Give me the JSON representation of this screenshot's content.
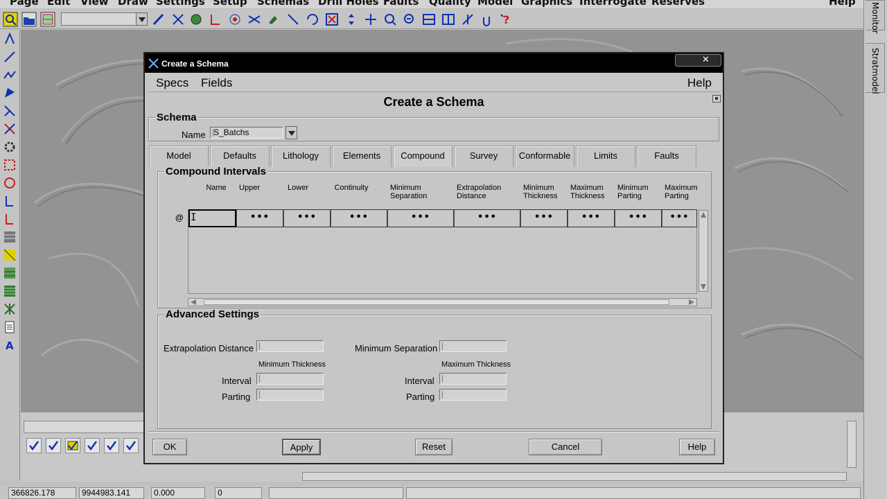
{
  "app": {
    "menu": [
      "Page",
      "Edit",
      "View",
      "Draw",
      "Settings",
      "Setup",
      "Schemas",
      "Drill Holes",
      "Faults",
      "Quality",
      "Model",
      "Graphics",
      "Interrogate",
      "Reserves",
      "Help"
    ],
    "right_tabs": [
      "Monitor",
      "Stratmodel"
    ],
    "status": {
      "x": "366826.178",
      "y": "9944983.141",
      "z": "0.000",
      "count": "0"
    }
  },
  "dialog": {
    "title": "Create a Schema",
    "menu": {
      "specs": "Specs",
      "fields": "Fields",
      "help": "Help"
    },
    "header": "Create a Schema",
    "schema": {
      "group_label": "Schema",
      "name_label": "Name",
      "name_value": "S_Batchs"
    },
    "tabs": [
      "Model",
      "Defaults",
      "Lithology",
      "Elements",
      "Compound",
      "Survey",
      "Conformable",
      "Limits",
      "Faults"
    ],
    "active_tab": "Compound",
    "compound": {
      "group_label": "Compound Intervals",
      "row_marker": "@",
      "columns": [
        {
          "line1": "",
          "line2": "Name"
        },
        {
          "line1": "",
          "line2": "Upper"
        },
        {
          "line1": "",
          "line2": "Lower"
        },
        {
          "line1": "",
          "line2": "Continuity"
        },
        {
          "line1": "Minimum",
          "line2": "Separation"
        },
        {
          "line1": "Extrapolation",
          "line2": "Distance"
        },
        {
          "line1": "Minimum",
          "line2": "Thickness"
        },
        {
          "line1": "Maximum",
          "line2": "Thickness"
        },
        {
          "line1": "Minimum",
          "line2": "Parting"
        },
        {
          "line1": "Maximum",
          "line2": "Parting"
        }
      ],
      "row_cells": [
        "",
        "•••",
        "•••",
        "•••",
        "•••",
        "•••",
        "•••",
        "•••",
        "•••",
        "•••"
      ]
    },
    "advanced": {
      "group_label": "Advanced Settings",
      "extrapolation_distance": "Extrapolation Distance",
      "minimum_separation": "Minimum Separation",
      "minimum_thickness": "Minimum Thickness",
      "maximum_thickness": "Maximum Thickness",
      "interval": "Interval",
      "parting": "Parting"
    },
    "buttons": {
      "ok": "OK",
      "apply": "Apply",
      "reset": "Reset",
      "cancel": "Cancel",
      "help": "Help"
    }
  }
}
